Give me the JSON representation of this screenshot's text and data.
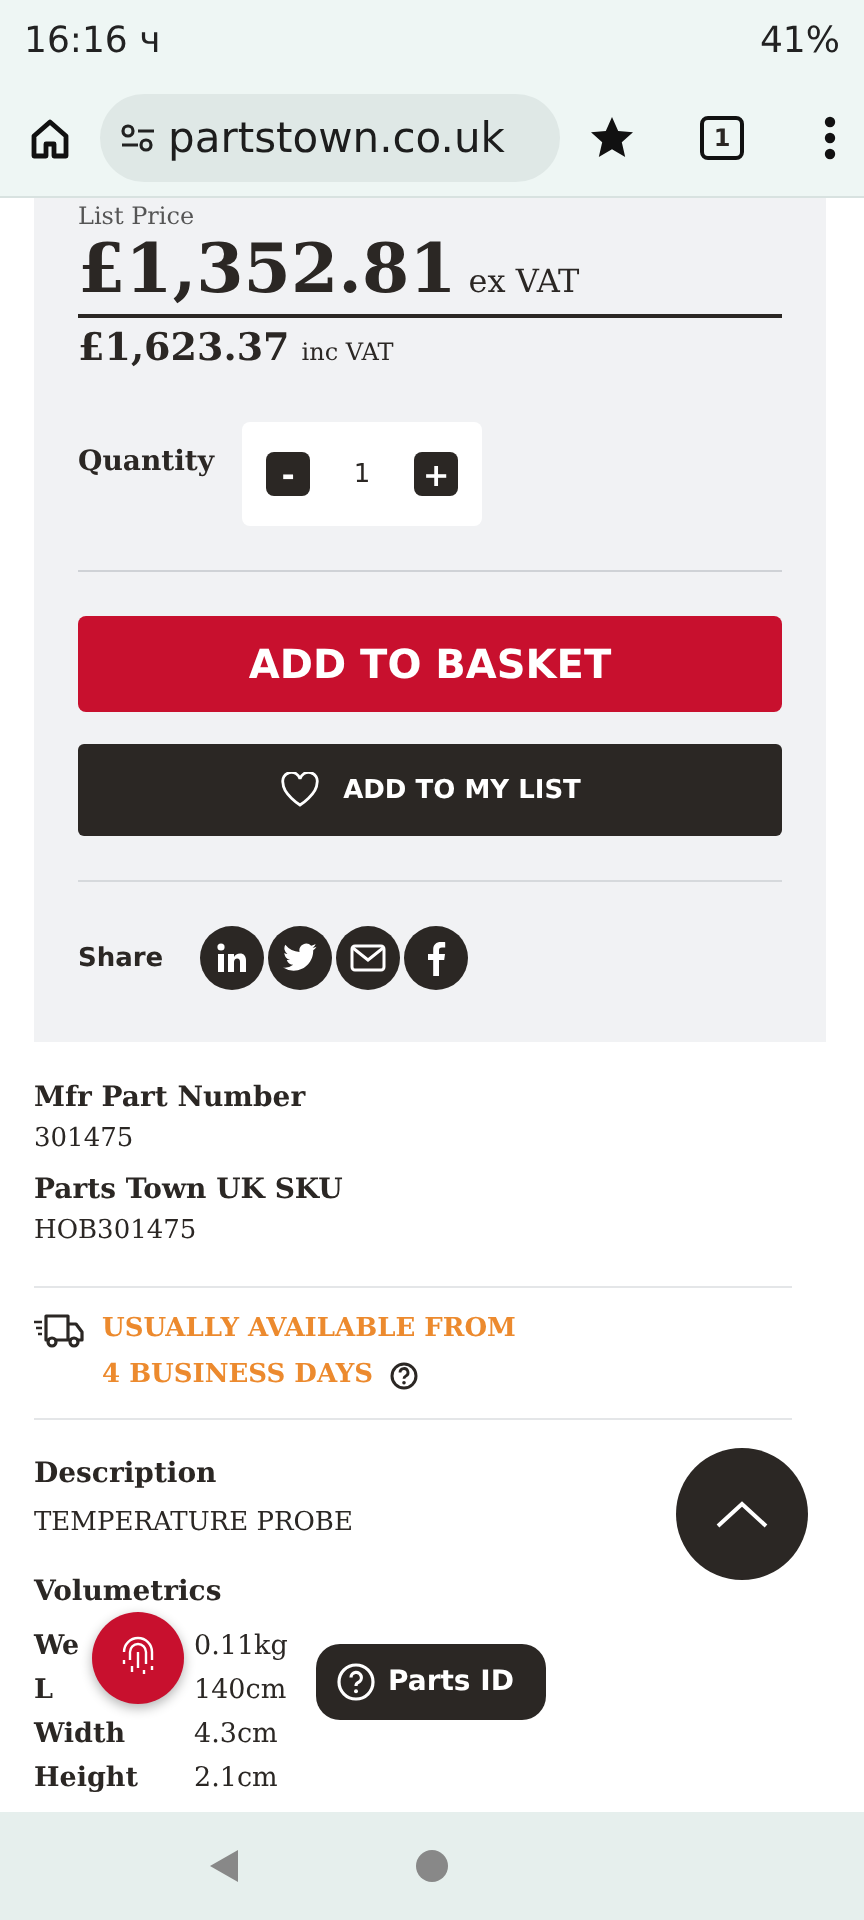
{
  "status_bar": {
    "time": "16:16 ч",
    "battery": "41%"
  },
  "browser": {
    "url": "partstown.co.uk",
    "tab_count": "1"
  },
  "price": {
    "label": "List Price",
    "ex_vat": "£1,352.81",
    "ex_vat_suffix": "ex VAT",
    "inc_vat": "£1,623.37",
    "inc_vat_suffix": "inc VAT"
  },
  "quantity": {
    "label": "Quantity",
    "value": "1",
    "decrease": "-",
    "increase": "+"
  },
  "add_to_basket": "ADD TO BASKET",
  "add_to_list": "ADD TO MY LIST",
  "share": {
    "label": "Share",
    "networks": [
      {
        "kind": "linkedin"
      },
      {
        "kind": "twitter"
      },
      {
        "kind": "email"
      },
      {
        "kind": "facebook"
      }
    ]
  },
  "details": [
    {
      "label": "Mfr Part Number",
      "value": "301475"
    },
    {
      "label": "Parts Town UK SKU",
      "value": "HOB301475"
    }
  ],
  "availability": [
    "USUALLY AVAILABLE FROM",
    "4 BUSINESS DAYS"
  ],
  "description": {
    "label": "Description",
    "value": "TEMPERATURE PROBE"
  },
  "volumetrics": {
    "label": "Volumetrics",
    "rows": [
      {
        "label": "We",
        "value": "0.11kg"
      },
      {
        "label": "L",
        "value": "140cm"
      },
      {
        "label": "Width",
        "value": "4.3cm"
      },
      {
        "label": "Height",
        "value": "2.1cm"
      }
    ]
  },
  "parts_id": "Parts ID"
}
